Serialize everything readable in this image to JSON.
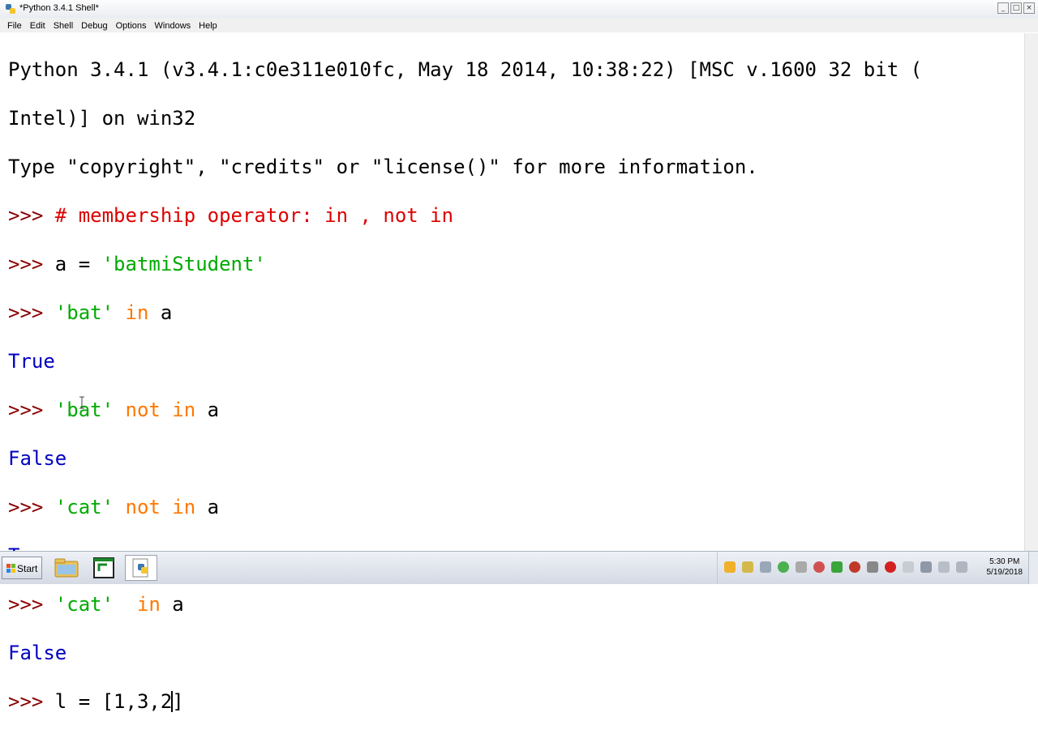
{
  "window": {
    "title": "*Python 3.4.1 Shell*",
    "minimize": "_",
    "maximize": "□",
    "close": "×"
  },
  "menu": [
    "File",
    "Edit",
    "Shell",
    "Debug",
    "Options",
    "Windows",
    "Help"
  ],
  "shell": {
    "banner1": "Python 3.4.1 (v3.4.1:c0e311e010fc, May 18 2014, 10:38:22) [MSC v.1600 32 bit (",
    "banner2": "Intel)] on win32",
    "banner3": "Type \"copyright\", \"credits\" or \"license()\" for more information.",
    "prompt": ">>> ",
    "comment": "# membership operator: in , not in",
    "l2_code": "a = ",
    "l2_str": "'batmiStudent'",
    "l3_str": "'bat'",
    "l3_kw": "in",
    "l3_tail": " a",
    "out_true": "True",
    "out_false": "False",
    "l5_str": "'bat'",
    "l5_kw": "not in",
    "l5_tail": " a",
    "l7_str": "'cat'",
    "l7_kw": "not in",
    "l7_tail": " a",
    "l9_str": "'cat'",
    "l9_kw": "in",
    "l9_tail": " a",
    "last_input_before_caret": "l = [1,3,2",
    "last_input_after_caret": "]"
  },
  "taskbar": {
    "start_label": "Start",
    "clock_time": "5:30 PM",
    "clock_date": "5/19/2018",
    "pinned": [
      "explorer-icon",
      "terminal-icon",
      "python-idle-icon"
    ]
  },
  "colors": {
    "prompt": "#8B0000",
    "output": "#0000c0",
    "keyword": "#ff7700",
    "string": "#00aa00",
    "comment": "#dd0000"
  }
}
